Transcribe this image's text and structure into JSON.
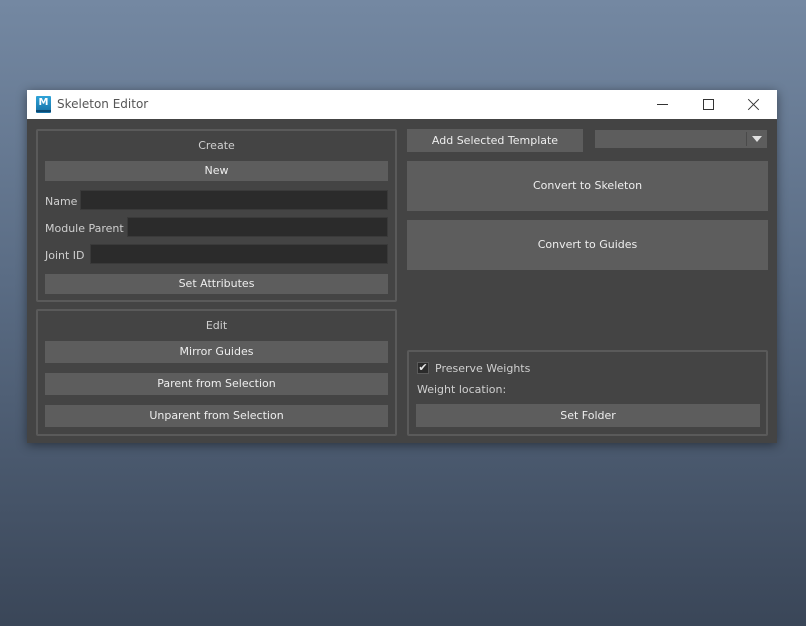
{
  "window": {
    "title": "Skeleton Editor",
    "app_icon_letter": "M",
    "controls": {
      "minimize": "minimize-icon",
      "maximize": "maximize-icon",
      "close": "close-icon"
    }
  },
  "create": {
    "title": "Create",
    "new_label": "New",
    "name_label": "Name",
    "name_value": "",
    "module_parent_label": "Module Parent",
    "module_parent_value": "",
    "joint_id_label": "Joint ID",
    "joint_id_value": "",
    "set_attributes_label": "Set Attributes"
  },
  "edit": {
    "title": "Edit",
    "mirror_label": "Mirror Guides",
    "parent_label": "Parent from Selection",
    "unparent_label": "Unparent from Selection"
  },
  "right": {
    "add_template_label": "Add Selected Template",
    "template_selected": "",
    "convert_skeleton_label": "Convert to Skeleton",
    "convert_guides_label": "Convert to Guides"
  },
  "weights": {
    "preserve_label": "Preserve Weights",
    "preserve_checked": true,
    "location_label": "Weight location:",
    "set_folder_label": "Set Folder"
  },
  "colors": {
    "panel_bg": "#444444",
    "button_bg": "#5d5d5d",
    "field_bg": "#2b2b2b",
    "desktop_top": "#7488a2",
    "desktop_bottom": "#3a4658"
  }
}
